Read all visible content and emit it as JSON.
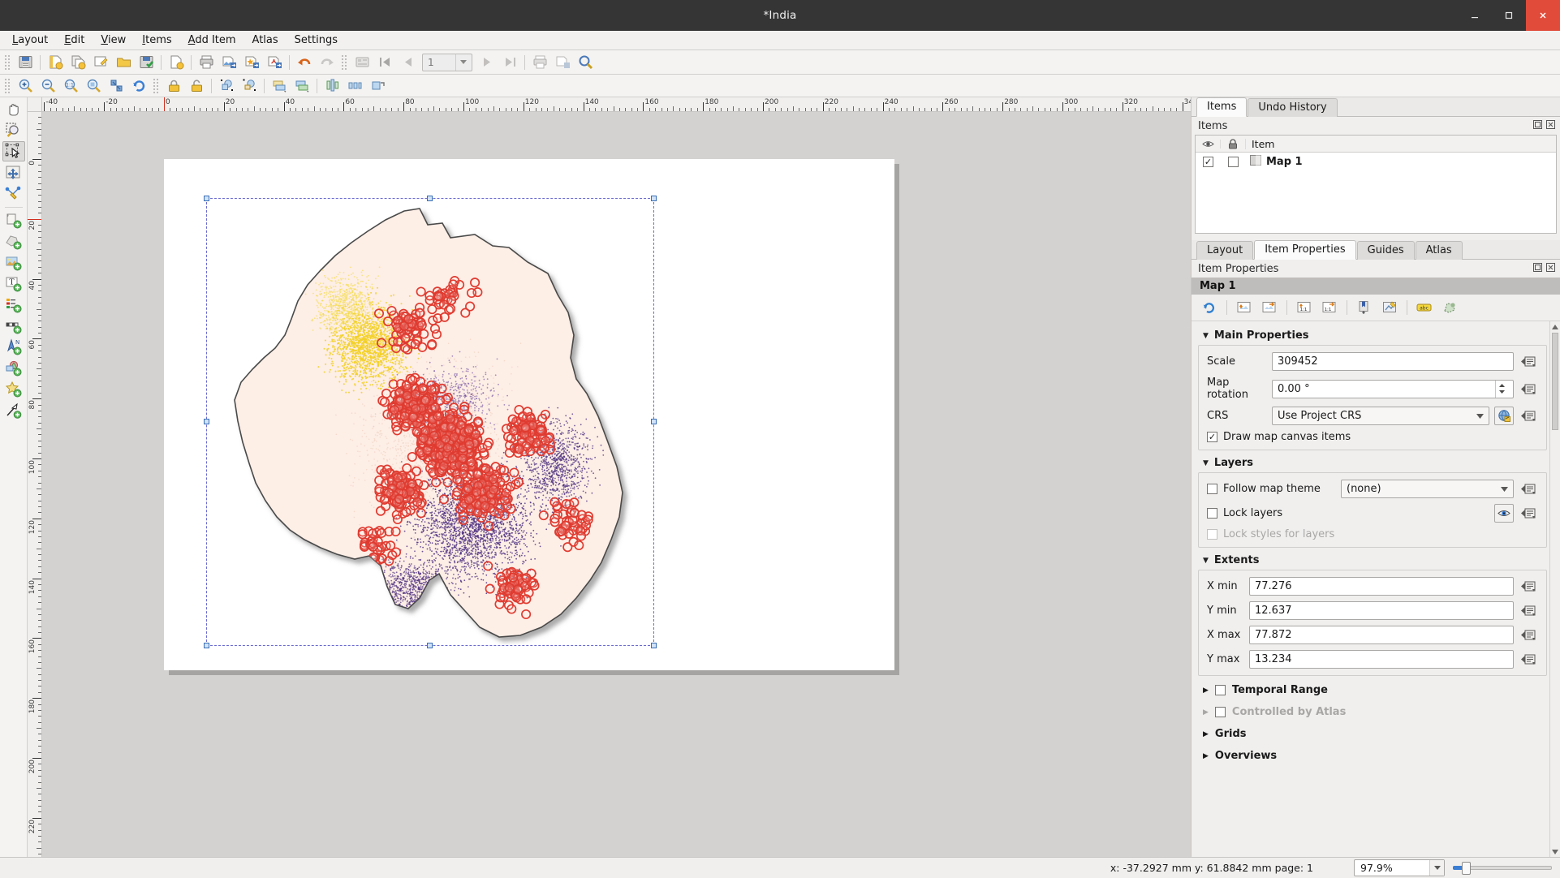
{
  "window": {
    "title": "*India",
    "controls": [
      "minimize-button",
      "maximize-button",
      "close-button"
    ]
  },
  "menubar": {
    "items": [
      {
        "label": "Layout",
        "mnemonic": "L"
      },
      {
        "label": "Edit",
        "mnemonic": "E"
      },
      {
        "label": "View",
        "mnemonic": "V"
      },
      {
        "label": "Items",
        "mnemonic": "I"
      },
      {
        "label": "Add Item",
        "mnemonic": "A"
      },
      {
        "label": "Atlas",
        "mnemonic": ""
      },
      {
        "label": "Settings",
        "mnemonic": ""
      }
    ]
  },
  "toolbar_main": {
    "buttons": [
      "save-layout-icon",
      "new-layout-icon",
      "duplicate-layout-icon",
      "layout-manager-icon",
      "open-layout-icon",
      "save-as-template-icon",
      "page-setup-icon",
      "print-icon",
      "export-image-icon",
      "export-svg-icon",
      "export-pdf-icon",
      "undo-icon",
      "redo-icon",
      "atlas-settings-icon",
      "atlas-first-icon",
      "atlas-prev-icon"
    ],
    "atlas_page_value": "1",
    "atlas_page_placeholder": "1",
    "buttons_after": [
      "atlas-next-icon",
      "atlas-last-icon",
      "atlas-print-icon",
      "atlas-export-icon",
      "atlas-preview-icon"
    ]
  },
  "toolbar_nav": {
    "buttons": [
      "zoom-in-icon",
      "zoom-out-icon",
      "zoom-full-icon",
      "zoom-actual-icon",
      "zoom-to-selection-icon",
      "refresh-view-icon",
      "lock-items-icon",
      "unlock-items-icon",
      "group-items-icon",
      "ungroup-items-icon",
      "raise-items-icon",
      "lower-items-icon",
      "align-items-icon",
      "distribute-items-icon",
      "resize-items-icon"
    ]
  },
  "toolbox": {
    "tools": [
      {
        "name": "pan-layout-tool",
        "active": false
      },
      {
        "name": "zoom-tool",
        "active": false
      },
      {
        "name": "select-move-item-tool",
        "active": true
      },
      {
        "name": "move-item-content-tool",
        "active": false
      },
      {
        "name": "edit-nodes-tool",
        "active": false
      },
      {
        "name": "add-map-tool",
        "active": false
      },
      {
        "name": "add-3d-map-tool",
        "active": false
      },
      {
        "name": "add-picture-tool",
        "active": false
      },
      {
        "name": "add-label-tool",
        "active": false
      },
      {
        "name": "add-legend-tool",
        "active": false
      },
      {
        "name": "add-scalebar-tool",
        "active": false
      },
      {
        "name": "add-north-arrow-tool",
        "active": false
      },
      {
        "name": "add-shape-tool",
        "active": false
      },
      {
        "name": "add-marker-tool",
        "active": false
      },
      {
        "name": "add-arrow-tool",
        "active": false
      }
    ]
  },
  "rulers": {
    "horizontal_ticks": [
      -20,
      0,
      20,
      40,
      60,
      80,
      100,
      120,
      140,
      160,
      180,
      200,
      220,
      240,
      260,
      280,
      300,
      320
    ],
    "vertical_ticks": [
      0,
      20,
      40,
      60,
      80,
      100,
      120,
      140,
      160,
      180,
      200,
      220
    ],
    "unit": "mm"
  },
  "items_dock": {
    "tabs": [
      {
        "label": "Items",
        "selected": true
      },
      {
        "label": "Undo History",
        "selected": false
      }
    ],
    "panel_title": "Items",
    "columns": [
      "visibility-column",
      "lock-column",
      "Item"
    ],
    "rows": [
      {
        "label": "Map 1",
        "visible": true,
        "locked": false
      }
    ]
  },
  "properties_dock": {
    "tabs": [
      {
        "label": "Layout",
        "selected": false
      },
      {
        "label": "Item Properties",
        "selected": true
      },
      {
        "label": "Guides",
        "selected": false
      },
      {
        "label": "Atlas",
        "selected": false
      }
    ],
    "panel_title": "Item Properties",
    "item_title": "Map 1",
    "action_icons": [
      "refresh-map-icon",
      "set-map-to-canvas-extent-icon",
      "set-canvas-to-map-extent-icon",
      "set-map-scale-to-canvas-icon",
      "set-canvas-scale-to-map-icon",
      "bookmark-icon",
      "interactive-edit-icon",
      "labeling-icon",
      "clipping-icon"
    ],
    "main_properties": {
      "title": "Main Properties",
      "scale_label": "Scale",
      "scale_value": "309452",
      "rotation_label": "Map rotation",
      "rotation_value": "0.00 °",
      "crs_label": "CRS",
      "crs_value": "Use Project CRS",
      "draw_canvas_items_label": "Draw map canvas items",
      "draw_canvas_items_checked": true
    },
    "layers": {
      "title": "Layers",
      "follow_map_theme_label": "Follow map theme",
      "follow_map_theme_checked": false,
      "map_theme_value": "(none)",
      "lock_layers_label": "Lock layers",
      "lock_layers_checked": false,
      "lock_styles_label": "Lock styles for layers",
      "lock_styles_checked": false,
      "lock_styles_enabled": false
    },
    "extents": {
      "title": "Extents",
      "x_min_label": "X min",
      "x_min_value": "77.276",
      "y_min_label": "Y min",
      "y_min_value": "12.637",
      "x_max_label": "X max",
      "x_max_value": "77.872",
      "y_max_label": "Y max",
      "y_max_value": "13.234"
    },
    "collapsed_sections": [
      {
        "label": "Temporal Range",
        "has_checkbox": true,
        "checked": false,
        "enabled": true
      },
      {
        "label": "Controlled by Atlas",
        "has_checkbox": true,
        "checked": false,
        "enabled": false
      },
      {
        "label": "Grids",
        "has_checkbox": false,
        "checked": false,
        "enabled": true
      },
      {
        "label": "Overviews",
        "has_checkbox": false,
        "checked": false,
        "enabled": true
      }
    ]
  },
  "statusbar": {
    "coordinates": "x: -37.2927 mm  y: 61.8842 mm  page: 1",
    "zoom_value": "97.9%"
  },
  "colors": {
    "accent": "#3a7fd5",
    "title_bar": "#353535",
    "close_button": "#e04b3a",
    "selection_frame": "#6a6ad0",
    "map_land": "#fdeee6",
    "map_points_red": "#e03b30",
    "map_points_yellow": "#f2d024",
    "map_points_purple": "#4b2d7f"
  }
}
